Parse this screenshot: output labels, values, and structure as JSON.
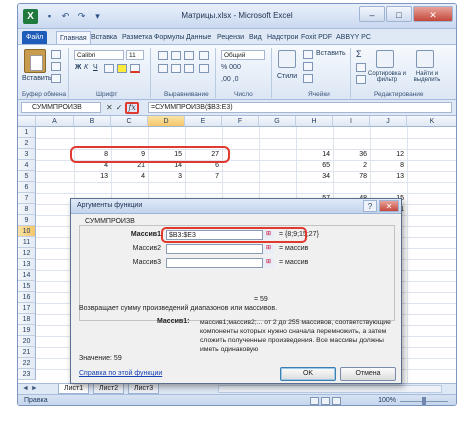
{
  "window": {
    "title": "Матрицы.xlsx - Microsoft Excel",
    "logo": "X",
    "qat_icons": [
      "save-icon",
      "undo-icon",
      "redo-icon",
      "dropdown-icon"
    ],
    "controls": {
      "minimize": "–",
      "maximize": "□",
      "close": "✕"
    }
  },
  "ribbon_tabs": [
    "Файл",
    "Главная",
    "Вставка",
    "Разметка",
    "Формулы",
    "Данные",
    "Рецензи",
    "Вид",
    "Надстрои",
    "Foxit PDF",
    "ABBYY PC"
  ],
  "ribbon": {
    "paste_label": "Вставить",
    "groups": [
      "Буфер обмена",
      "Шрифт",
      "Выравнивание",
      "Число",
      "Ячейки",
      "Редактирование"
    ],
    "font_name": "Calibri",
    "font_size": "11",
    "number_format": "Общий",
    "styles_label": "Стили",
    "insert_label": "Вставить",
    "sort_label": "Сортировка и фильтр",
    "find_label": "Найти и выделить",
    "sigma": "Σ"
  },
  "formula_bar": {
    "name_box": "СУММПРОИЗВ",
    "cancel": "✕",
    "enter": "✓",
    "fx": "fx",
    "formula": "=СУММПРОИЗВ($B3:E3)"
  },
  "columns": [
    "A",
    "B",
    "C",
    "D",
    "E",
    "F",
    "G",
    "H",
    "I",
    "J",
    "K"
  ],
  "rows": [
    "1",
    "2",
    "3",
    "4",
    "5",
    "6",
    "7",
    "8",
    "9",
    "10",
    "11",
    "12",
    "13",
    "14",
    "15",
    "16",
    "17",
    "18",
    "19",
    "20",
    "21",
    "22",
    "23"
  ],
  "cells": {
    "r3": [
      "8",
      "9",
      "15",
      "27",
      "14",
      "36",
      "12"
    ],
    "r4": [
      "4",
      "21",
      "14",
      "6",
      "65",
      "2",
      "8"
    ],
    "r5": [
      "13",
      "4",
      "3",
      "7",
      "34",
      "78",
      "13"
    ],
    "r7": [
      "57",
      "48",
      "15"
    ],
    "r8": [
      "48",
      "98",
      "21"
    ]
  },
  "sheets": {
    "nav": "◄ ►",
    "tabs": [
      "Лист1",
      "Лист2",
      "Лист3"
    ]
  },
  "status": {
    "text": "Правка",
    "zoom": "100%"
  },
  "dialog": {
    "title": "Аргументы функции",
    "help": "?",
    "close": "✕",
    "function_name": "СУММПРОИЗВ",
    "args": [
      {
        "label": "Массив1",
        "value": "$B3:$E3",
        "result": "= {8;9;15;27}"
      },
      {
        "label": "Массив2",
        "value": "",
        "result": "= массив"
      },
      {
        "label": "Массив3",
        "value": "",
        "result": "= массив"
      }
    ],
    "total": "= 59",
    "description": "Возвращает сумму произведений диапазонов или массивов.",
    "arg_desc_label": "Массив1:",
    "arg_desc": "массив1;массив2;... от 2 до 255 массивов, соответствующие компоненты которых нужно сначала перемножить, а затем сложить полученные произведения. Все массивы должны иметь одинаковую",
    "value_label": "Значение:  59",
    "help_link": "Справка по этой функции",
    "ok": "OK",
    "cancel": "Отмена"
  }
}
